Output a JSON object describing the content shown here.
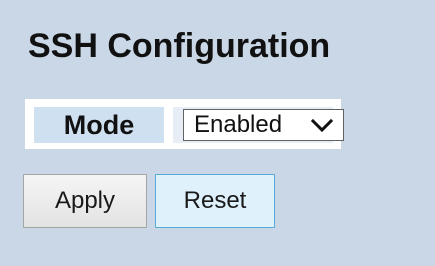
{
  "page": {
    "title": "SSH Configuration"
  },
  "form": {
    "mode_label": "Mode",
    "mode_value": "Enabled"
  },
  "buttons": {
    "apply_label": "Apply",
    "reset_label": "Reset"
  },
  "icons": {
    "dropdown": "chevron-down-icon"
  },
  "colors": {
    "page_background": "#c9d7e6",
    "label_background": "#cfe1f1",
    "reset_border": "#58a9d8"
  }
}
